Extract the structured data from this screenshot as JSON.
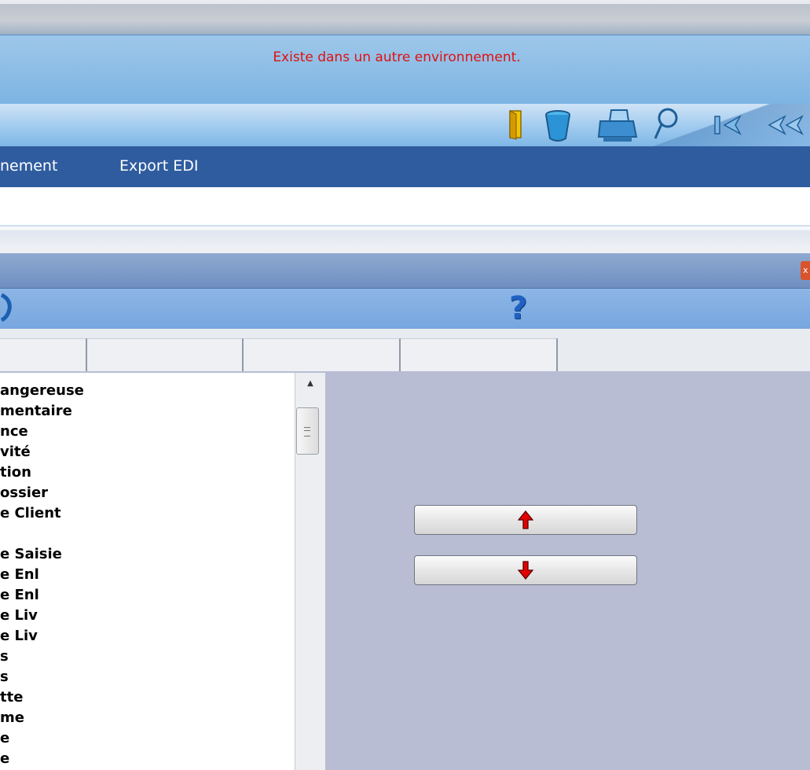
{
  "banner": {
    "message": "Existe dans un autre environnement."
  },
  "menu": {
    "items": [
      "nement",
      "Export EDI"
    ]
  },
  "toolbar": {
    "icons": [
      "door-icon",
      "trash-bucket-icon",
      "printer-icon",
      "search-icon",
      "first-record-icon",
      "previous-record-icon"
    ]
  },
  "dialog": {
    "help_symbol": "?",
    "tabs": [
      "",
      "",
      "",
      ""
    ],
    "close_symbol": "x",
    "list_items": [
      "angereuse",
      "mentaire",
      "nce",
      "vité",
      "tion",
      "ossier",
      "e Client",
      "",
      "e Saisie",
      "e Enl",
      "e Enl",
      "e Liv",
      "e Liv",
      "s",
      "s",
      "tte",
      "me",
      "e",
      "e"
    ],
    "buttons": {
      "move_up": "move-up-arrow-icon",
      "move_down": "move-down-arrow-icon"
    }
  }
}
